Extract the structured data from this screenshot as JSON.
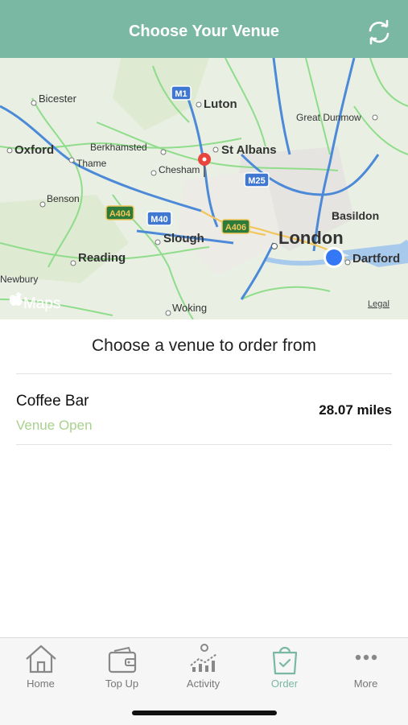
{
  "header": {
    "title": "Choose Your Venue",
    "refresh_icon": "refresh-icon"
  },
  "map": {
    "attribution": "Maps",
    "legal": "Legal",
    "places": [
      "Bicester",
      "Luton",
      "Great Dunmow",
      "Oxford",
      "Berkhamsted",
      "St Albans",
      "Thame",
      "Chesham",
      "Benson",
      "Basildon",
      "Slough",
      "London",
      "Reading",
      "Dartford",
      "Newbury",
      "Woking"
    ],
    "roads": [
      "M1",
      "M25",
      "A404",
      "M40",
      "A406"
    ],
    "colors": {
      "user_location": "#3478f6",
      "pin": "#e8453c"
    }
  },
  "main": {
    "section_title": "Choose a venue to order from",
    "venues": [
      {
        "name": "Coffee Bar",
        "status": "Venue Open",
        "distance": "28.07 miles"
      }
    ]
  },
  "tabs": [
    {
      "label": "Home",
      "icon": "home-icon",
      "active": false
    },
    {
      "label": "Top Up",
      "icon": "wallet-icon",
      "active": false
    },
    {
      "label": "Activity",
      "icon": "activity-chart-icon",
      "active": false
    },
    {
      "label": "Order",
      "icon": "shopping-bag-icon",
      "active": true
    },
    {
      "label": "More",
      "icon": "more-dots-icon",
      "active": false
    }
  ],
  "colors": {
    "accent": "#7ab8a3",
    "status_open": "#a9d18e"
  }
}
